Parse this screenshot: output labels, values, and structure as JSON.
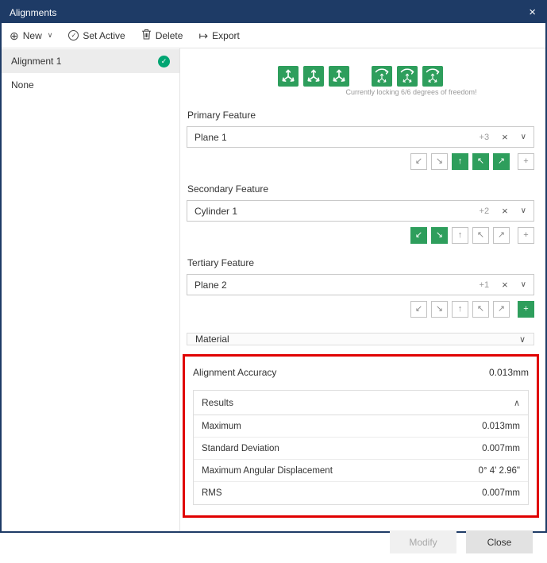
{
  "colors": {
    "titlebar": "#1e3b66",
    "accent_green": "#2e9e5c",
    "check_teal": "#00a572",
    "annotation_red": "#e00000"
  },
  "window": {
    "title": "Alignments"
  },
  "icons": {
    "close": "×",
    "new_circle": "⊕",
    "check": "✓",
    "export_arrow": "↦",
    "chevron_down": "∨",
    "chevron_up": "∧",
    "clear": "×"
  },
  "toolbar": {
    "new_label": "New",
    "set_active_label": "Set Active",
    "delete_label": "Delete",
    "export_label": "Export"
  },
  "sidebar": {
    "items": [
      {
        "label": "Alignment 1",
        "active": true
      },
      {
        "label": "None",
        "active": false
      }
    ]
  },
  "dof": {
    "caption": "Currently locking 6/6 degrees of freedom!"
  },
  "toggle_glyphs": [
    "↙",
    "↘",
    "↑",
    "↖",
    "↗",
    "+"
  ],
  "features": [
    {
      "label": "Primary Feature",
      "value": "Plane 1",
      "badge": "+3",
      "toggles": [
        false,
        false,
        true,
        true,
        true,
        false
      ]
    },
    {
      "label": "Secondary Feature",
      "value": "Cylinder 1",
      "badge": "+2",
      "toggles": [
        true,
        true,
        false,
        false,
        false,
        false
      ]
    },
    {
      "label": "Tertiary Feature",
      "value": "Plane 2",
      "badge": "+1",
      "toggles": [
        false,
        false,
        false,
        false,
        false,
        true
      ]
    }
  ],
  "material": {
    "label": "Material"
  },
  "accuracy": {
    "label": "Alignment Accuracy",
    "value": "0.013mm"
  },
  "results": {
    "title": "Results",
    "rows": [
      {
        "label": "Maximum",
        "value": "0.013mm"
      },
      {
        "label": "Standard Deviation",
        "value": "0.007mm"
      },
      {
        "label": "Maximum Angular Displacement",
        "value": "0° 4' 2.96\""
      },
      {
        "label": "RMS",
        "value": "0.007mm"
      }
    ]
  },
  "footer": {
    "modify_label": "Modify",
    "close_label": "Close"
  }
}
